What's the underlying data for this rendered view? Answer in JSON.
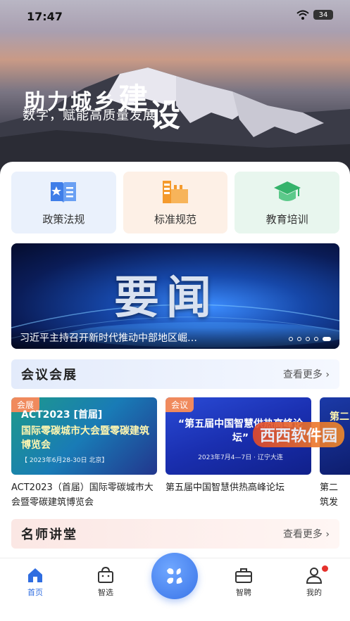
{
  "status": {
    "time": "17:47",
    "battery": "34"
  },
  "hero": {
    "title_part1": "助力城乡",
    "title_part2": "建",
    "title_part3": "设",
    "subtitle": "数字，赋能高质量发展"
  },
  "quick_links": [
    {
      "label": "政策法规",
      "icon": "policy-book-icon",
      "color": "#3f7ee8"
    },
    {
      "label": "标准规范",
      "icon": "standard-chart-icon",
      "color": "#f49a2d"
    },
    {
      "label": "教育培训",
      "icon": "graduation-cap-icon",
      "color": "#35b36b"
    }
  ],
  "banner": {
    "title": "要闻",
    "caption": "习近平主持召开新时代推动中部地区崛…",
    "slide_count": 5,
    "active_slide": 5
  },
  "sections": {
    "exhibitions": {
      "title": "会议会展",
      "more": "查看更多 ›"
    },
    "lectures": {
      "title": "名师讲堂",
      "more": "查看更多 ›"
    }
  },
  "cards": [
    {
      "tag": "会展",
      "img_line1": "ACT2023 [首届]",
      "img_line2": "国际零碳城市大会暨零碳建筑博览会",
      "img_line3": "【 2023年6月28-30日 北京】",
      "text": "ACT2023（首届）国际零碳城市大会暨零碳建筑博览会"
    },
    {
      "tag": "会议",
      "img_line1": "",
      "img_line2": "“第五届中国智慧供热高峰论坛”",
      "img_line3": "2023年7月4—7日 · 辽宁大连",
      "text": "第五届中国智慧供热高峰论坛"
    },
    {
      "tag": "",
      "img_line1": "",
      "img_line2": "第二",
      "img_line3": "",
      "text": "第二筑发"
    }
  ],
  "tabbar": [
    {
      "label": "首页",
      "icon": "home-icon",
      "active": true
    },
    {
      "label": "智选",
      "icon": "shopping-bag-icon",
      "active": false
    },
    {
      "label": "",
      "icon": "center-app-icon",
      "active": false
    },
    {
      "label": "智聘",
      "icon": "briefcase-icon",
      "active": false
    },
    {
      "label": "我的",
      "icon": "user-icon",
      "active": false
    }
  ],
  "watermark": "西西软件园"
}
